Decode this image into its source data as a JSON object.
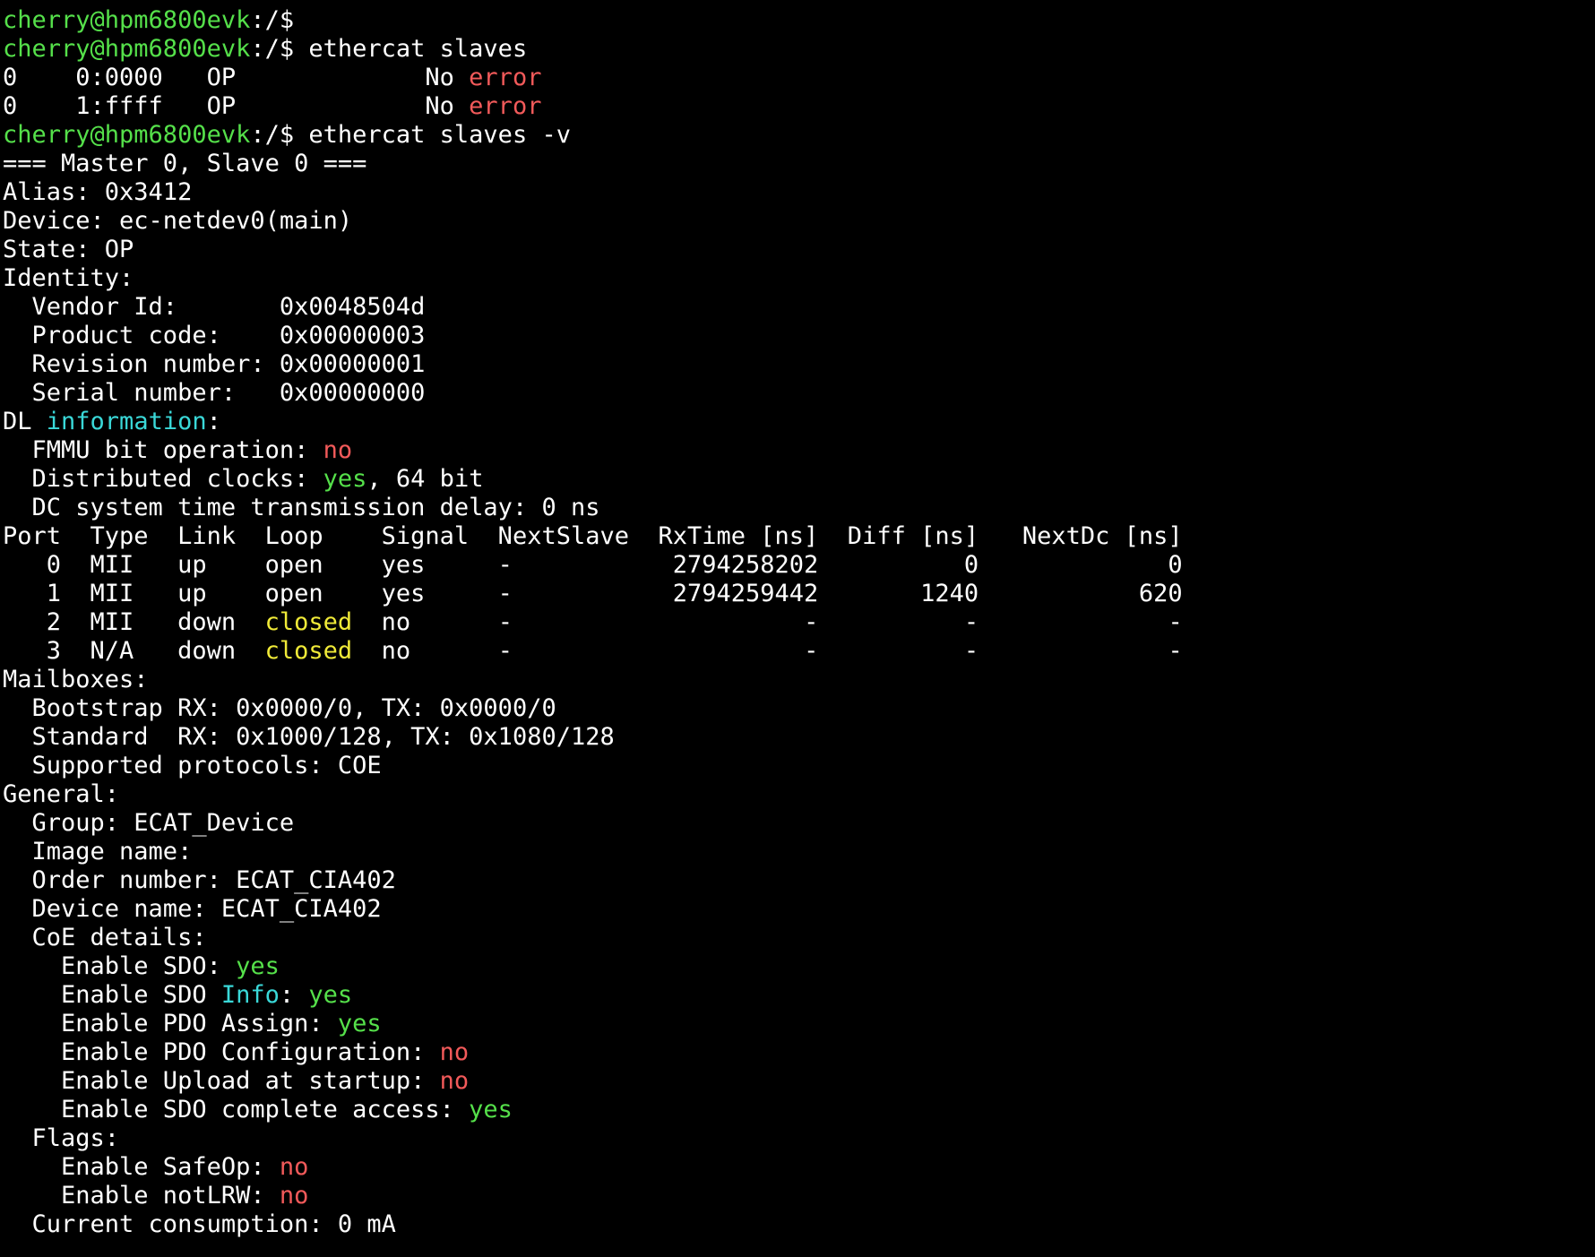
{
  "terminal": {
    "lines": [
      [
        {
          "t": "cherry@hpm6800evk",
          "c": "prompt"
        },
        {
          "t": ":/$ "
        }
      ],
      [
        {
          "t": "cherry@hpm6800evk",
          "c": "prompt"
        },
        {
          "t": ":/$ ethercat slaves"
        }
      ],
      [
        {
          "t": "0    0:0000   OP             No "
        },
        {
          "t": "error",
          "c": "red"
        }
      ],
      [
        {
          "t": "0    1:ffff   OP             No "
        },
        {
          "t": "error",
          "c": "red"
        }
      ],
      [
        {
          "t": "cherry@hpm6800evk",
          "c": "prompt"
        },
        {
          "t": ":/$ ethercat slaves -v"
        }
      ],
      [
        {
          "t": "=== Master 0, Slave 0 ==="
        }
      ],
      [
        {
          "t": "Alias: 0x3412"
        }
      ],
      [
        {
          "t": "Device: ec-netdev0(main)"
        }
      ],
      [
        {
          "t": "State: OP"
        }
      ],
      [
        {
          "t": "Identity:"
        }
      ],
      [
        {
          "t": "  Vendor Id:       0x0048504d"
        }
      ],
      [
        {
          "t": "  Product code:    0x00000003"
        }
      ],
      [
        {
          "t": "  Revision number: 0x00000001"
        }
      ],
      [
        {
          "t": "  Serial number:   0x00000000"
        }
      ],
      [
        {
          "t": "DL "
        },
        {
          "t": "information",
          "c": "cyan"
        },
        {
          "t": ":"
        }
      ],
      [
        {
          "t": "  FMMU bit operation: "
        },
        {
          "t": "no",
          "c": "red"
        }
      ],
      [
        {
          "t": "  Distributed clocks: "
        },
        {
          "t": "yes",
          "c": "green"
        },
        {
          "t": ", 64 bit"
        }
      ],
      [
        {
          "t": "  DC system time transmission delay: 0 ns"
        }
      ],
      [
        {
          "t": "Port  Type  Link  Loop    Signal  NextSlave  RxTime [ns]  Diff [ns]   NextDc [ns]"
        }
      ],
      [
        {
          "t": "   0  MII   up    open    yes     -           2794258202          0             0"
        }
      ],
      [
        {
          "t": "   1  MII   up    open    yes     -           2794259442       1240           620"
        }
      ],
      [
        {
          "t": "   2  MII   down  "
        },
        {
          "t": "closed",
          "c": "yellow"
        },
        {
          "t": "  no      -                    -          -             -"
        }
      ],
      [
        {
          "t": "   3  N/A   down  "
        },
        {
          "t": "closed",
          "c": "yellow"
        },
        {
          "t": "  no      -                    -          -             -"
        }
      ],
      [
        {
          "t": "Mailboxes:"
        }
      ],
      [
        {
          "t": "  Bootstrap RX: 0x0000/0, TX: 0x0000/0"
        }
      ],
      [
        {
          "t": "  Standard  RX: 0x1000/128, TX: 0x1080/128"
        }
      ],
      [
        {
          "t": "  Supported protocols: COE"
        }
      ],
      [
        {
          "t": "General:"
        }
      ],
      [
        {
          "t": "  Group: ECAT_Device"
        }
      ],
      [
        {
          "t": "  Image name:"
        }
      ],
      [
        {
          "t": "  Order number: ECAT_CIA402"
        }
      ],
      [
        {
          "t": "  Device name: ECAT_CIA402"
        }
      ],
      [
        {
          "t": "  CoE details:"
        }
      ],
      [
        {
          "t": "    Enable SDO: "
        },
        {
          "t": "yes",
          "c": "green"
        }
      ],
      [
        {
          "t": "    Enable SDO "
        },
        {
          "t": "Info",
          "c": "cyan"
        },
        {
          "t": ": "
        },
        {
          "t": "yes",
          "c": "green"
        }
      ],
      [
        {
          "t": "    Enable PDO Assign: "
        },
        {
          "t": "yes",
          "c": "green"
        }
      ],
      [
        {
          "t": "    Enable PDO Configuration: "
        },
        {
          "t": "no",
          "c": "red"
        }
      ],
      [
        {
          "t": "    Enable Upload at startup: "
        },
        {
          "t": "no",
          "c": "red"
        }
      ],
      [
        {
          "t": "    Enable SDO complete access: "
        },
        {
          "t": "yes",
          "c": "green"
        }
      ],
      [
        {
          "t": "  Flags:"
        }
      ],
      [
        {
          "t": "    Enable SafeOp: "
        },
        {
          "t": "no",
          "c": "red"
        }
      ],
      [
        {
          "t": "    Enable notLRW: "
        },
        {
          "t": "no",
          "c": "red"
        }
      ],
      [
        {
          "t": "  Current consumption: 0 mA"
        }
      ]
    ]
  },
  "colors": {
    "background": "#000000",
    "foreground": "#ffffff",
    "prompt": "#55e04a",
    "red": "#f25a5a",
    "green": "#55e04a",
    "cyan": "#3ad8d8",
    "yellow": "#f0ea38"
  }
}
